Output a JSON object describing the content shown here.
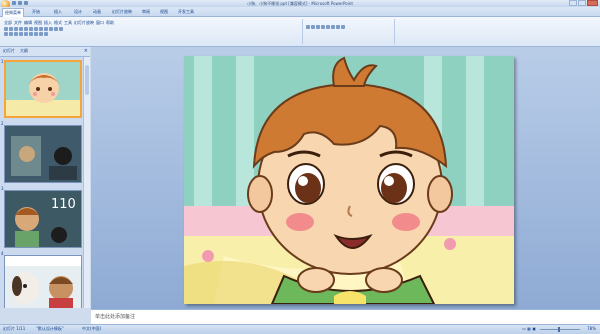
{
  "window": {
    "title": "小狗、小狗不睡觉.ppt [兼容模式] - Microsoft PowerPoint"
  },
  "menu": {
    "tabs": [
      "经典菜单",
      "开始",
      "插入",
      "设计",
      "动画",
      "幻灯片放映",
      "审阅",
      "视图",
      "开发工具"
    ],
    "active_index": 0
  },
  "ribbon": {
    "classic_menus": [
      "全部",
      "文件",
      "编辑",
      "视图",
      "插入",
      "格式",
      "工具",
      "幻灯片放映",
      "窗口",
      "帮助"
    ]
  },
  "panel": {
    "tabs": [
      "幻灯片",
      "大纲"
    ]
  },
  "thumbnails": [
    {
      "number": "1"
    },
    {
      "number": "2"
    },
    {
      "number": "3",
      "overlay_text": "110"
    },
    {
      "number": "4"
    }
  ],
  "notes": {
    "placeholder": "单击此处添加备注"
  },
  "status": {
    "slide_info": "幻灯片 1/11",
    "theme": "\"默认设计模板\"",
    "language": "中文(中国)",
    "zoom": "78%"
  },
  "colors": {
    "ribbon_blue": "#dce8f6",
    "selection_orange": "#f3a53a"
  }
}
